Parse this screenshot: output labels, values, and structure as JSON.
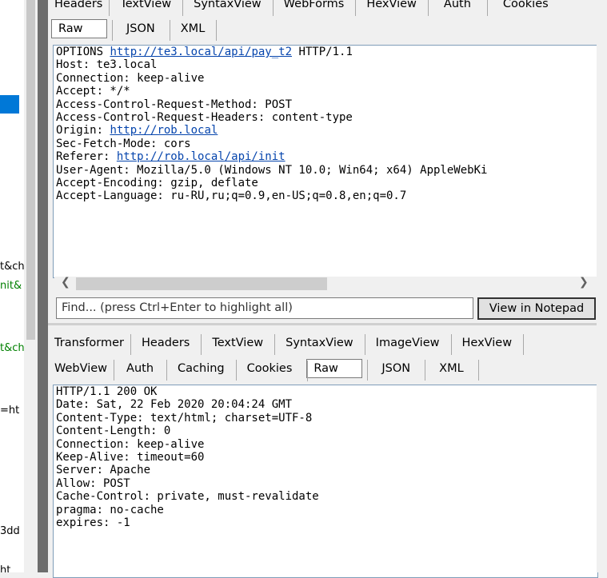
{
  "left_fragments": [
    "t&ch",
    "nit&",
    "t&ch",
    "=ht",
    "3dd",
    "ht"
  ],
  "request": {
    "tabs_row1": [
      "Headers",
      "TextView",
      "SyntaxView",
      "WebForms",
      "HexView",
      "Auth",
      "Cookies"
    ],
    "tabs_row2": [
      "Raw",
      "JSON",
      "XML"
    ],
    "selected_tab": "Raw",
    "lines": [
      {
        "text": "OPTIONS ",
        "link": "http://te3.local/api/pay_t2",
        "after": " HTTP/1.1"
      },
      {
        "text": "Host: te3.local"
      },
      {
        "text": "Connection: keep-alive"
      },
      {
        "text": "Accept: */*"
      },
      {
        "text": "Access-Control-Request-Method: POST"
      },
      {
        "text": "Access-Control-Request-Headers: content-type"
      },
      {
        "text": "Origin: ",
        "link": "http://rob.local"
      },
      {
        "text": "Sec-Fetch-Mode: cors"
      },
      {
        "text": "Referer: ",
        "link": "http://rob.local/api/init"
      },
      {
        "text": "User-Agent: Mozilla/5.0 (Windows NT 10.0; Win64; x64) AppleWebKi"
      },
      {
        "text": "Accept-Encoding: gzip, deflate"
      },
      {
        "text": "Accept-Language: ru-RU,ru;q=0.9,en-US;q=0.8,en;q=0.7"
      }
    ]
  },
  "find": {
    "placeholder": "Find... (press Ctrl+Enter to highlight all)",
    "button_label": "View in Notepad"
  },
  "response": {
    "tabs_row1": [
      "Transformer",
      "Headers",
      "TextView",
      "SyntaxView",
      "ImageView",
      "HexView"
    ],
    "tabs_row2": [
      "WebView",
      "Auth",
      "Caching",
      "Cookies",
      "Raw",
      "JSON",
      "XML"
    ],
    "selected_tab": "Raw",
    "lines": [
      {
        "text": "HTTP/1.1 200 OK"
      },
      {
        "text": "Date: Sat, 22 Feb 2020 20:04:24 GMT"
      },
      {
        "text": "Content-Type: text/html; charset=UTF-8"
      },
      {
        "text": "Content-Length: 0"
      },
      {
        "text": "Connection: keep-alive"
      },
      {
        "text": "Keep-Alive: timeout=60"
      },
      {
        "text": "Server: Apache"
      },
      {
        "text": "Allow: POST"
      },
      {
        "text": "Cache-Control: private, must-revalidate"
      },
      {
        "text": "pragma: no-cache"
      },
      {
        "text": "expires: -1"
      }
    ]
  },
  "colors": {
    "link": "#0645ad",
    "selection": "#0078d7",
    "green_text": "#008000"
  }
}
